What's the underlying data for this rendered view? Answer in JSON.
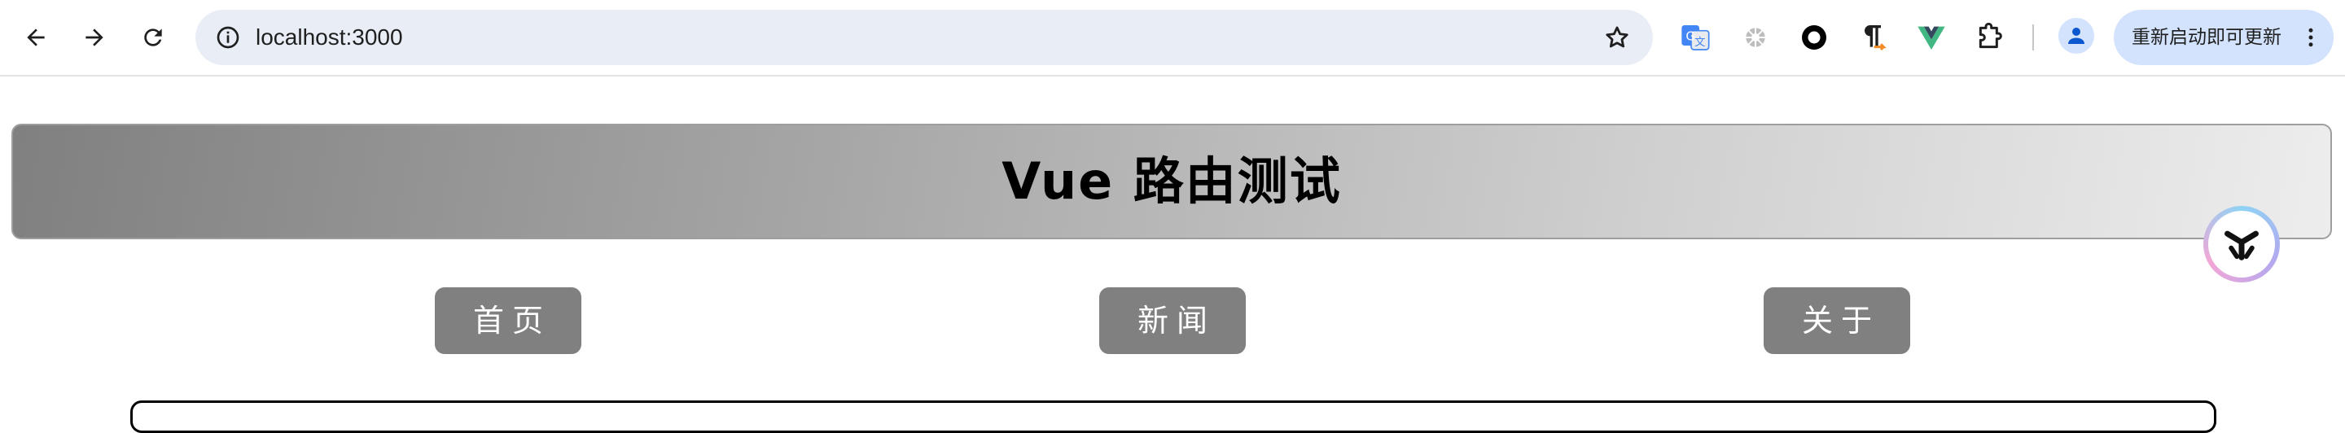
{
  "browser": {
    "url": "localhost:3000",
    "update_button_label": "重新启动即可更新",
    "icons": {
      "back": "arrow-left-icon",
      "forward": "arrow-right-icon",
      "reload": "reload-icon",
      "site_info": "info-icon",
      "bookmark": "star-icon",
      "menu": "more-vertical-icon"
    },
    "extensions": [
      "google-translate-icon",
      "extension-gear-icon",
      "circle-extension-icon",
      "pilcrow-extension-icon",
      "vue-devtools-icon",
      "puzzle-extensions-icon"
    ],
    "accent_color": "#d3e3fd"
  },
  "page": {
    "header_title": "Vue 路由测试",
    "nav_links": [
      {
        "label": "首页"
      },
      {
        "label": "新闻"
      },
      {
        "label": "关于"
      }
    ],
    "link_color": "#808080"
  }
}
